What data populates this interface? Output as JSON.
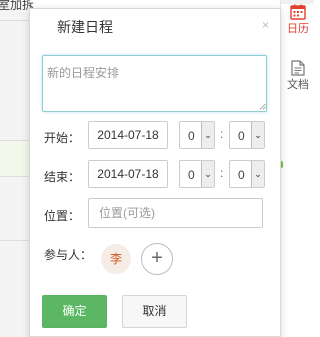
{
  "background": {
    "left_text": "室加拆",
    "right_nav": [
      {
        "label": "日历",
        "icon": "calendar-icon",
        "active": true
      },
      {
        "label": "文档",
        "icon": "document-icon",
        "active": false
      }
    ]
  },
  "dialog": {
    "title": "新建日程",
    "close_glyph": "×",
    "content_placeholder": "新的日程安排",
    "start": {
      "label": "开始：",
      "date": "2014-07-18",
      "hour": "0",
      "minute": "0"
    },
    "end": {
      "label": "结束：",
      "date": "2014-07-18",
      "hour": "0",
      "minute": "0"
    },
    "location": {
      "label": "位置：",
      "placeholder": "位置(可选)"
    },
    "participants": {
      "label": "参与人：",
      "avatar_initial": "李",
      "add_glyph": "+"
    },
    "time_separator": ":",
    "dropdown_arrow": "⌄",
    "confirm_label": "确定",
    "cancel_label": "取消"
  },
  "colors": {
    "accent_green": "#5cb765",
    "calendar_red": "#e0402e",
    "avatar_text": "#d2561b"
  }
}
